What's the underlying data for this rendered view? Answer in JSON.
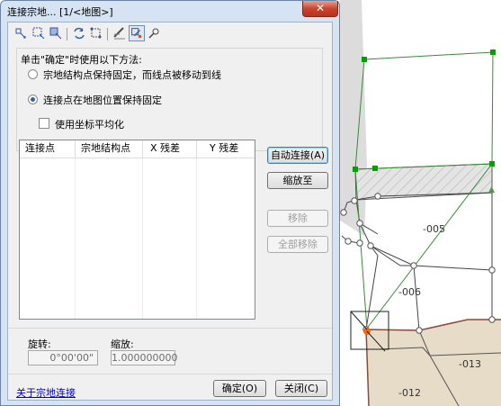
{
  "dialog": {
    "title": "连接宗地... [1/<地图>]",
    "close_glyph": "✕",
    "instruction": "单击\"确定\"时使用以下方法:",
    "options": [
      {
        "label": "宗地结构点保持固定，而线点被移动到线",
        "selected": false
      },
      {
        "label": "连接点在地图位置保持固定",
        "selected": true
      }
    ],
    "checkbox_label": "使用坐标平均化",
    "checkbox_checked": false,
    "table_headers": [
      "连接点",
      "宗地结构点",
      "X 残差",
      "Y 残差"
    ],
    "buttons": {
      "auto_connect": "自动连接(A)",
      "zoom_to": "缩放至",
      "remove": "移除",
      "remove_all": "全部移除",
      "ok": "确定(O)",
      "close": "关闭(C)"
    },
    "rotation_label": "旋转:",
    "rotation_value": "0°00'00\"",
    "scale_label": "缩放:",
    "scale_value": "1.000000000",
    "help_link": "关于宗地连接",
    "toolbar_icons": [
      "add-point-icon",
      "add-area-icon",
      "add-line-icon",
      "refresh-icon",
      "select-icon",
      "edit-icon",
      "map-connect-icon",
      "move-icon"
    ]
  },
  "map": {
    "parcel_labels": [
      "-005",
      "-006",
      "-013",
      "-012"
    ],
    "colors": {
      "green": "#008000",
      "node_green": "#00a000",
      "orange": "#ff6600",
      "parcel_fill": "#e6dcc8",
      "parcel_edge": "#8b4a3a"
    }
  }
}
